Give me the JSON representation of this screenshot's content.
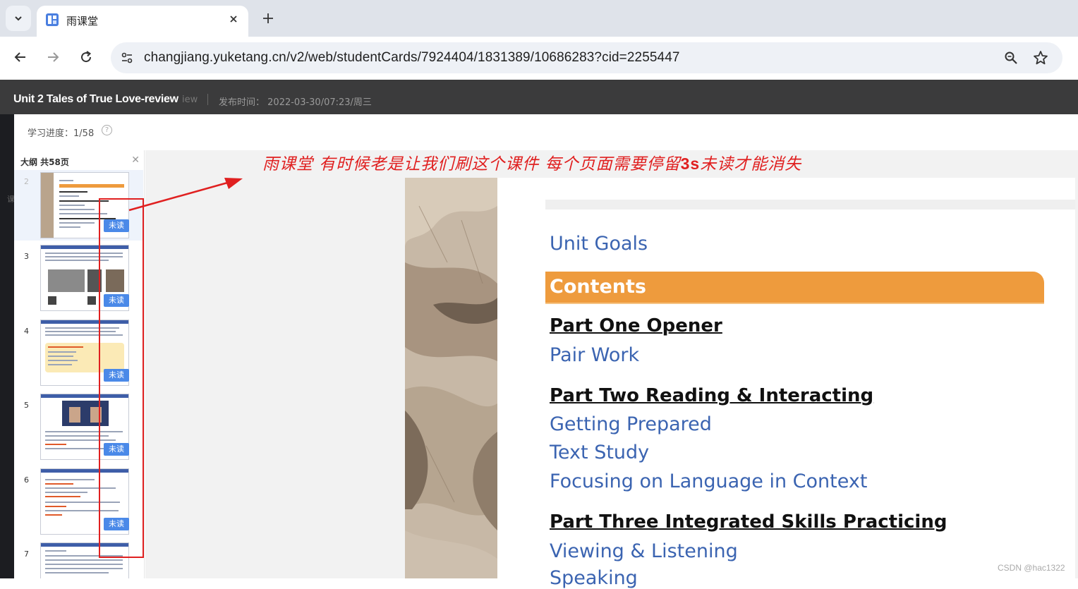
{
  "browser": {
    "tab_title": "雨课堂",
    "url": "changjiang.yuketang.cn/v2/web/studentCards/7924404/1831389/10686283?cid=2255447"
  },
  "header": {
    "title": "Unit 2 Tales of True Love-review",
    "ghost_text": "iew",
    "publish_label": "发布时间：",
    "publish_time": "2022-03-30/07:23/周三"
  },
  "left_rail_char": "课",
  "progress": {
    "label": "学习进度：",
    "value": "1/58"
  },
  "outline": {
    "title": "大纲 共58页",
    "items": [
      {
        "num": "2",
        "badge": "未读"
      },
      {
        "num": "3",
        "badge": "未读"
      },
      {
        "num": "4",
        "badge": "未读"
      },
      {
        "num": "5",
        "badge": "未读"
      },
      {
        "num": "6",
        "badge": "未读"
      },
      {
        "num": "7",
        "badge": ""
      }
    ]
  },
  "slide": {
    "unit_goals": "Unit Goals",
    "contents": "Contents",
    "part1": "Part One  Opener",
    "part1_sub": [
      "Pair Work"
    ],
    "part2": "Part Two  Reading & Interacting",
    "part2_sub": [
      "Getting Prepared",
      "Text Study",
      "Focusing on Language in Context"
    ],
    "part3": "Part Three  Integrated Skills Practicing",
    "part3_sub": [
      "Viewing & Listening",
      "Speaking"
    ]
  },
  "annotation": {
    "text_a": "雨课堂 有时候老是让我们刷这个课件  每个页面需要停留",
    "text_bold": "3s",
    "text_b": "未读才能消失"
  },
  "watermark": "CSDN @hac1322",
  "colors": {
    "accent_orange": "#ee9b3d",
    "link_blue": "#3b64b1",
    "annotation_red": "#e02020",
    "badge_blue": "#4a89e8"
  }
}
